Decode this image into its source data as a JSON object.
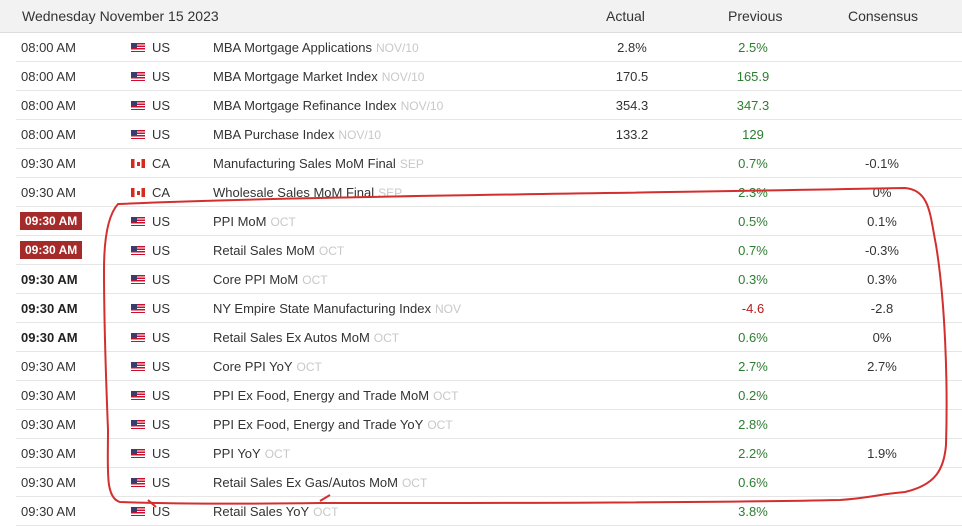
{
  "header": {
    "date": "Wednesday November 15 2023",
    "col_actual": "Actual",
    "col_previous": "Previous",
    "col_consensus": "Consensus"
  },
  "colors": {
    "badge": "#a52a2a",
    "green": "#2e7d32",
    "red": "#b71c1c",
    "annotation": "#d32f2f"
  },
  "rows": [
    {
      "time": "08:00 AM",
      "time_style": "normal",
      "flag": "us-flag-icon",
      "country": "US",
      "event": "MBA Mortgage Applications",
      "period": "NOV/10",
      "actual": "2.8%",
      "previous": "2.5%",
      "previous_color": "green",
      "consensus": ""
    },
    {
      "time": "08:00 AM",
      "time_style": "normal",
      "flag": "us-flag-icon",
      "country": "US",
      "event": "MBA Mortgage Market Index",
      "period": "NOV/10",
      "actual": "170.5",
      "previous": "165.9",
      "previous_color": "green",
      "consensus": ""
    },
    {
      "time": "08:00 AM",
      "time_style": "normal",
      "flag": "us-flag-icon",
      "country": "US",
      "event": "MBA Mortgage Refinance Index",
      "period": "NOV/10",
      "actual": "354.3",
      "previous": "347.3",
      "previous_color": "green",
      "consensus": ""
    },
    {
      "time": "08:00 AM",
      "time_style": "normal",
      "flag": "us-flag-icon",
      "country": "US",
      "event": "MBA Purchase Index",
      "period": "NOV/10",
      "actual": "133.2",
      "previous": "129",
      "previous_color": "green",
      "consensus": ""
    },
    {
      "time": "09:30 AM",
      "time_style": "normal",
      "flag": "ca-flag-icon",
      "country": "CA",
      "event": "Manufacturing Sales MoM Final",
      "period": "SEP",
      "actual": "",
      "previous": "0.7%",
      "previous_color": "green",
      "consensus": "-0.1%"
    },
    {
      "time": "09:30 AM",
      "time_style": "normal",
      "flag": "ca-flag-icon",
      "country": "CA",
      "event": "Wholesale Sales MoM Final",
      "period": "SEP",
      "actual": "",
      "previous": "2.3%",
      "previous_color": "green",
      "consensus": "0%"
    },
    {
      "time": "09:30 AM",
      "time_style": "badge",
      "flag": "us-flag-icon",
      "country": "US",
      "event": "PPI MoM",
      "period": "OCT",
      "actual": "",
      "previous": "0.5%",
      "previous_color": "green",
      "consensus": "0.1%"
    },
    {
      "time": "09:30 AM",
      "time_style": "badge",
      "flag": "us-flag-icon",
      "country": "US",
      "event": "Retail Sales MoM",
      "period": "OCT",
      "actual": "",
      "previous": "0.7%",
      "previous_color": "green",
      "consensus": "-0.3%"
    },
    {
      "time": "09:30 AM",
      "time_style": "bold",
      "flag": "us-flag-icon",
      "country": "US",
      "event": "Core PPI MoM",
      "period": "OCT",
      "actual": "",
      "previous": "0.3%",
      "previous_color": "green",
      "consensus": "0.3%"
    },
    {
      "time": "09:30 AM",
      "time_style": "bold",
      "flag": "us-flag-icon",
      "country": "US",
      "event": "NY Empire State Manufacturing Index",
      "period": "NOV",
      "actual": "",
      "previous": "-4.6",
      "previous_color": "red",
      "consensus": "-2.8"
    },
    {
      "time": "09:30 AM",
      "time_style": "bold",
      "flag": "us-flag-icon",
      "country": "US",
      "event": "Retail Sales Ex Autos MoM",
      "period": "OCT",
      "actual": "",
      "previous": "0.6%",
      "previous_color": "green",
      "consensus": "0%"
    },
    {
      "time": "09:30 AM",
      "time_style": "normal",
      "flag": "us-flag-icon",
      "country": "US",
      "event": "Core PPI YoY",
      "period": "OCT",
      "actual": "",
      "previous": "2.7%",
      "previous_color": "green",
      "consensus": "2.7%"
    },
    {
      "time": "09:30 AM",
      "time_style": "normal",
      "flag": "us-flag-icon",
      "country": "US",
      "event": "PPI Ex Food, Energy and Trade MoM",
      "period": "OCT",
      "actual": "",
      "previous": "0.2%",
      "previous_color": "green",
      "consensus": ""
    },
    {
      "time": "09:30 AM",
      "time_style": "normal",
      "flag": "us-flag-icon",
      "country": "US",
      "event": "PPI Ex Food, Energy and Trade YoY",
      "period": "OCT",
      "actual": "",
      "previous": "2.8%",
      "previous_color": "green",
      "consensus": ""
    },
    {
      "time": "09:30 AM",
      "time_style": "normal",
      "flag": "us-flag-icon",
      "country": "US",
      "event": "PPI YoY",
      "period": "OCT",
      "actual": "",
      "previous": "2.2%",
      "previous_color": "green",
      "consensus": "1.9%"
    },
    {
      "time": "09:30 AM",
      "time_style": "normal",
      "flag": "us-flag-icon",
      "country": "US",
      "event": "Retail Sales Ex Gas/Autos MoM",
      "period": "OCT",
      "actual": "",
      "previous": "0.6%",
      "previous_color": "green",
      "consensus": ""
    },
    {
      "time": "09:30 AM",
      "time_style": "normal",
      "flag": "us-flag-icon",
      "country": "US",
      "event": "Retail Sales YoY",
      "period": "OCT",
      "actual": "",
      "previous": "3.8%",
      "previous_color": "green",
      "consensus": ""
    }
  ]
}
